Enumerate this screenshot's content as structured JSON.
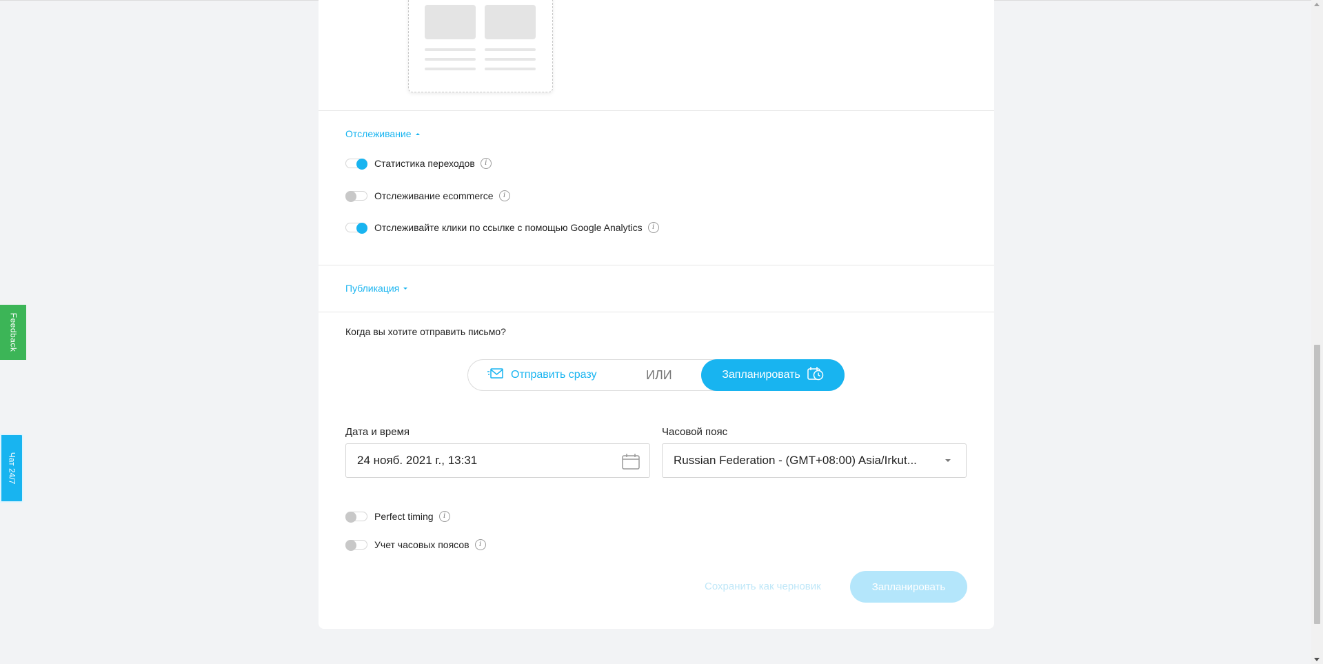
{
  "tracking": {
    "section_label": "Отслеживание",
    "options": [
      {
        "label": "Статистика переходов",
        "enabled": true
      },
      {
        "label": "Отслеживание ecommerce",
        "enabled": false
      },
      {
        "label": "Отслеживайте клики по ссылке с помощью Google Analytics",
        "enabled": true
      }
    ]
  },
  "publication": {
    "section_label": "Публикация",
    "question": "Когда вы хотите отправить письмо?",
    "send_now_label": "Отправить сразу",
    "or_label": "ИЛИ",
    "schedule_label": "Запланировать",
    "date_label": "Дата и время",
    "date_value": "24 нояб. 2021 г., 13:31",
    "timezone_label": "Часовой пояс",
    "timezone_value": "Russian Federation - (GMT+08:00) Asia/Irkut...",
    "perfect_timing_label": "Perfect timing",
    "perfect_timing_enabled": false,
    "timezones_label": "Учет часовых поясов",
    "timezones_enabled": false
  },
  "footer": {
    "save_draft_label": "Сохранить как черновик",
    "schedule_button_label": "Запланировать"
  },
  "side_tabs": {
    "feedback_label": "Feedback",
    "chat_label": "Чат 24/7"
  },
  "colors": {
    "accent": "#18b4f0",
    "feedback": "#3cb557"
  }
}
